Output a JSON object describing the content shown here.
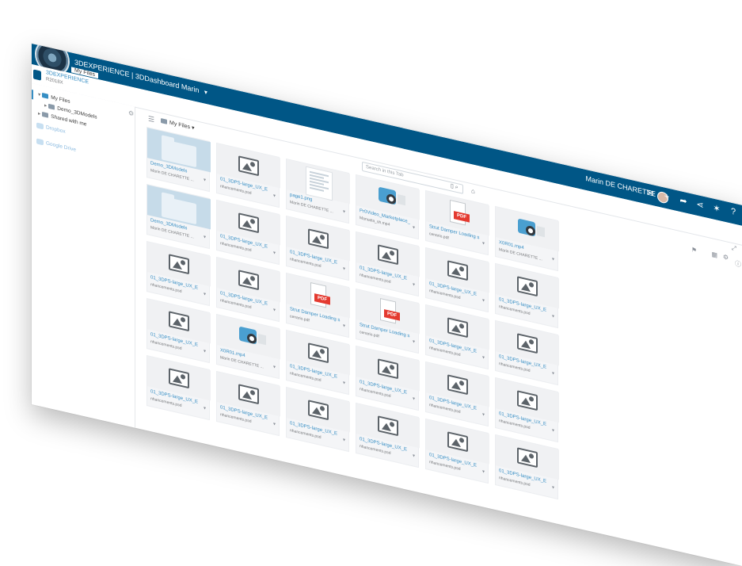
{
  "topbar": {
    "title": "3DEXPERIENCE | 3DDashboard Marin",
    "user": "Marin DE CHARETTE",
    "icons": [
      "chat-icon",
      "plus-icon",
      "share-icon",
      "network-icon",
      "tools-icon",
      "help-icon"
    ]
  },
  "apphead": {
    "app_name": "3DEXPERIENCE",
    "app_sub": "R2018X",
    "page": "My Files"
  },
  "sidebar": {
    "my_files": "My Files",
    "demo_folder": "Demo_3DModels",
    "shared": "Shared with me",
    "dropbox": "Dropbox",
    "gdrive": "Google Drive"
  },
  "content": {
    "crumb": "My Files",
    "search_placeholder": "Search in this Tab"
  },
  "tiles": [
    {
      "type": "folder",
      "name": "Demo_3DModels",
      "sub": "Marin DE CHARETTE ..."
    },
    {
      "type": "image",
      "name": "01_3DPS-large_UX_E",
      "sub": "nhancements.psd"
    },
    {
      "type": "doc",
      "name": "page1.png",
      "sub": "Marin DE CHARETTE ..."
    },
    {
      "type": "video",
      "name": "Pr0Video_Marketplace_",
      "sub": "Manuela_sh.mp4"
    },
    {
      "type": "pdf",
      "name": "Strut Damper Loading s",
      "sub": "cenario.pdf"
    },
    {
      "type": "video",
      "name": "X0R01.mp4",
      "sub": "Marin DE CHARETTE ..."
    },
    {
      "type": "folder",
      "name": "Demo_3DModels",
      "sub": "Marin DE CHARETTE ..."
    },
    {
      "type": "image",
      "name": "01_3DPS-large_UX_E",
      "sub": "nhancements.psd"
    },
    {
      "type": "image",
      "name": "01_3DPS-large_UX_E",
      "sub": "nhancements.psd"
    },
    {
      "type": "image",
      "name": "01_3DPS-large_UX_E",
      "sub": "nhancements.psd"
    },
    {
      "type": "image",
      "name": "01_3DPS-large_UX_E",
      "sub": "nhancements.psd"
    },
    {
      "type": "image",
      "name": "01_3DPS-large_UX_E",
      "sub": "nhancements.psd"
    },
    {
      "type": "image",
      "name": "01_3DPS-large_UX_E",
      "sub": "nhancements.psd"
    },
    {
      "type": "image",
      "name": "01_3DPS-large_UX_E",
      "sub": "nhancements.psd"
    },
    {
      "type": "pdf",
      "name": "Strut Damper Loading s",
      "sub": "cenario.pdf"
    },
    {
      "type": "pdf",
      "name": "Strut Damper Loading s",
      "sub": "cenario.pdf"
    },
    {
      "type": "image",
      "name": "01_3DPS-large_UX_E",
      "sub": "nhancements.psd"
    },
    {
      "type": "image",
      "name": "01_3DPS-large_UX_E",
      "sub": "nhancements.psd"
    },
    {
      "type": "image",
      "name": "01_3DPS-large_UX_E",
      "sub": "nhancements.psd"
    },
    {
      "type": "video",
      "name": "X0R01.mp4",
      "sub": "Marin DE CHARETTE ..."
    },
    {
      "type": "image",
      "name": "01_3DPS-large_UX_E",
      "sub": "nhancements.psd"
    },
    {
      "type": "image",
      "name": "01_3DPS-large_UX_E",
      "sub": "nhancements.psd"
    },
    {
      "type": "image",
      "name": "01_3DPS-large_UX_E",
      "sub": "nhancements.psd"
    },
    {
      "type": "image",
      "name": "01_3DPS-large_UX_E",
      "sub": "nhancements.psd"
    },
    {
      "type": "image",
      "name": "01_3DPS-large_UX_E",
      "sub": "nhancements.psd"
    },
    {
      "type": "image",
      "name": "01_3DPS-large_UX_E",
      "sub": "nhancements.psd"
    },
    {
      "type": "image",
      "name": "01_3DPS-large_UX_E",
      "sub": "nhancements.psd"
    },
    {
      "type": "image",
      "name": "01_3DPS-large_UX_E",
      "sub": "nhancements.psd"
    },
    {
      "type": "image",
      "name": "01_3DPS-large_UX_E",
      "sub": "nhancements.psd"
    },
    {
      "type": "image",
      "name": "01_3DPS-large_UX_E",
      "sub": "nhancements.psd"
    }
  ]
}
